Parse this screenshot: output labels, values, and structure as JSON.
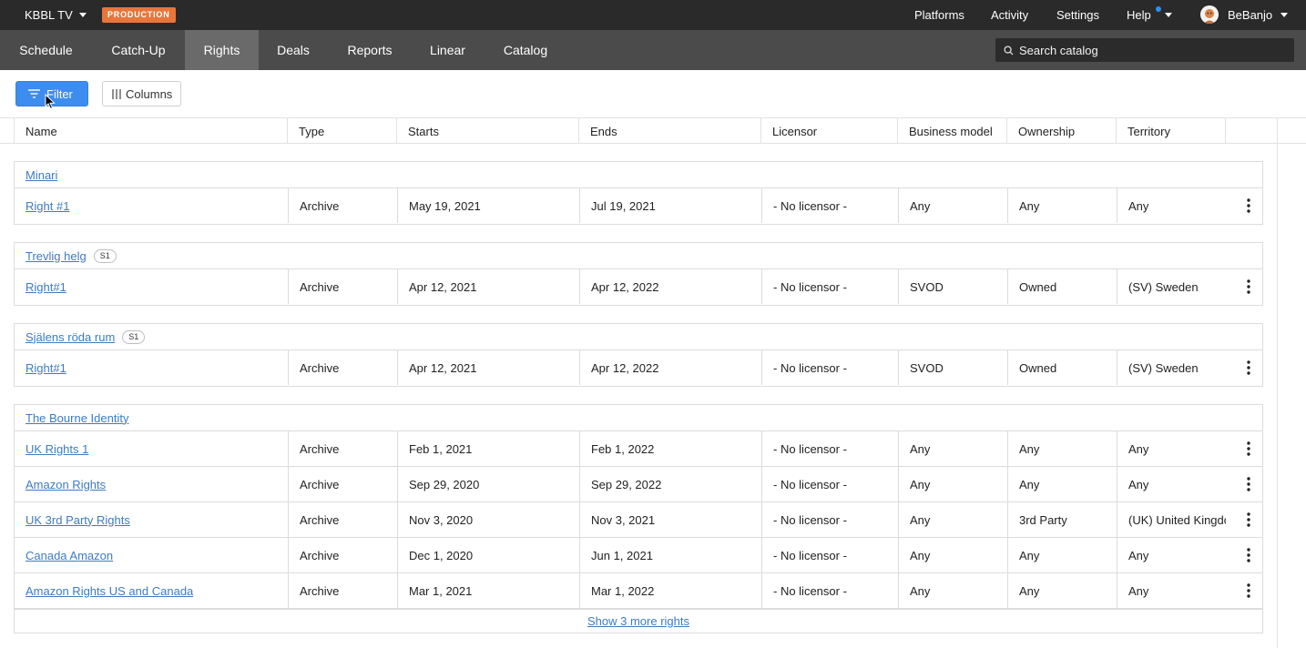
{
  "topbar": {
    "brand": "KBBL TV",
    "environment": "PRODUCTION",
    "links": [
      "Platforms",
      "Activity",
      "Settings",
      "Help"
    ],
    "user": "BeBanjo"
  },
  "nav": {
    "tabs": [
      "Schedule",
      "Catch-Up",
      "Rights",
      "Deals",
      "Reports",
      "Linear",
      "Catalog"
    ],
    "active": "Rights",
    "search_placeholder": "Search catalog"
  },
  "toolbar": {
    "filter_label": "Filter",
    "columns_label": "Columns"
  },
  "table": {
    "columns": [
      "Name",
      "Type",
      "Starts",
      "Ends",
      "Licensor",
      "Business model",
      "Ownership",
      "Territory"
    ],
    "groups": [
      {
        "title": "Minari",
        "badge": "",
        "rows": [
          [
            "Right #1",
            "Archive",
            "May 19, 2021",
            "Jul 19, 2021",
            "- No licensor -",
            "Any",
            "Any",
            "Any"
          ]
        ]
      },
      {
        "title": "Trevlig helg",
        "badge": "S1",
        "rows": [
          [
            "Right#1",
            "Archive",
            "Apr 12, 2021",
            "Apr 12, 2022",
            "- No licensor -",
            "SVOD",
            "Owned",
            "(SV) Sweden"
          ]
        ]
      },
      {
        "title": "Själens röda rum",
        "badge": "S1",
        "rows": [
          [
            "Right#1",
            "Archive",
            "Apr 12, 2021",
            "Apr 12, 2022",
            "- No licensor -",
            "SVOD",
            "Owned",
            "(SV) Sweden"
          ]
        ]
      },
      {
        "title": "The Bourne Identity",
        "badge": "",
        "rows": [
          [
            "UK Rights 1",
            "Archive",
            "Feb 1, 2021",
            "Feb 1, 2022",
            "- No licensor -",
            "Any",
            "Any",
            "Any"
          ],
          [
            "Amazon Rights",
            "Archive",
            "Sep 29, 2020",
            "Sep 29, 2022",
            "- No licensor -",
            "Any",
            "Any",
            "Any"
          ],
          [
            "UK 3rd Party Rights",
            "Archive",
            "Nov 3, 2020",
            "Nov 3, 2021",
            "- No licensor -",
            "Any",
            "3rd Party",
            "(UK) United Kingdom"
          ],
          [
            "Canada Amazon",
            "Archive",
            "Dec 1, 2020",
            "Jun 1, 2021",
            "- No licensor -",
            "Any",
            "Any",
            "Any"
          ],
          [
            "Amazon Rights US and Canada",
            "Archive",
            "Mar 1, 2021",
            "Mar 1, 2022",
            "- No licensor -",
            "Any",
            "Any",
            "Any"
          ]
        ],
        "more_label": "Show 3 more rights"
      }
    ]
  },
  "colors": {
    "accent": "#3d8cf0",
    "link": "#3d7bc2",
    "badge": "#e8763a",
    "topbar": "#2a2a2a",
    "navbar": "#4b4b4b"
  },
  "icons": [
    "caret-down-icon",
    "search-icon",
    "filter-icon",
    "columns-icon",
    "kebab-menu-icon",
    "avatar-icon",
    "mouse-cursor-icon"
  ]
}
